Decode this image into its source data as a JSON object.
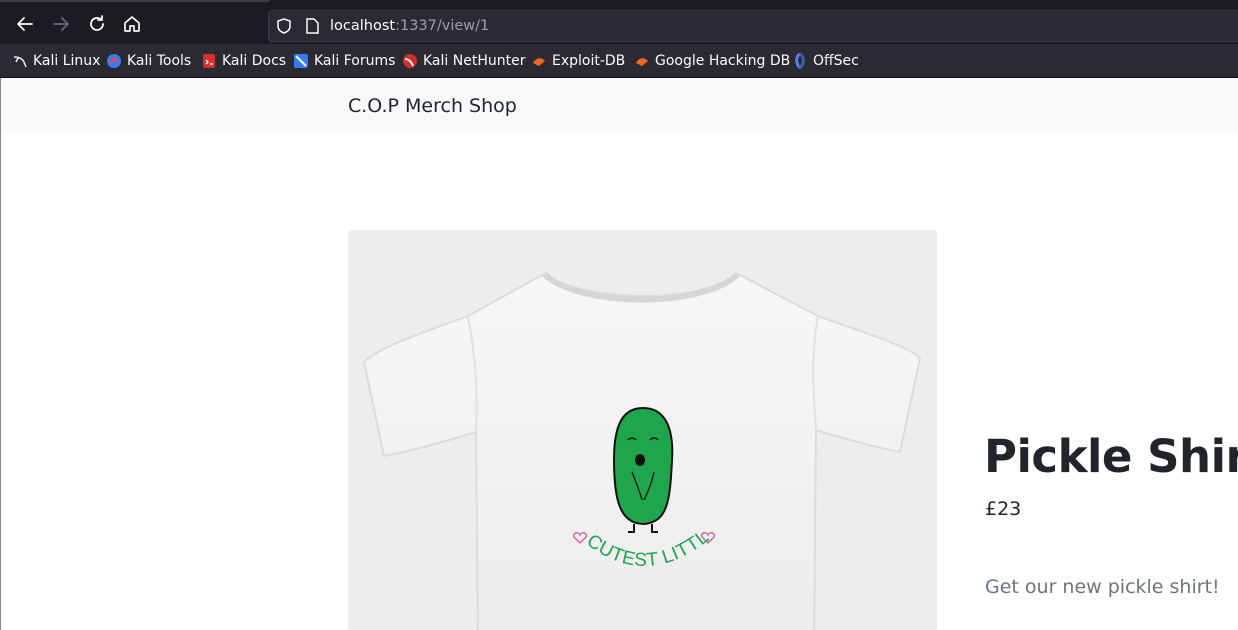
{
  "browser": {
    "url_host": "localhost",
    "url_path": ":1337/view/1",
    "bookmarks": [
      {
        "label": "Kali Linux",
        "icon": "kali-dragon-icon"
      },
      {
        "label": "Kali Tools",
        "icon": "kali-tools-icon"
      },
      {
        "label": "Kali Docs",
        "icon": "kali-docs-icon"
      },
      {
        "label": "Kali Forums",
        "icon": "kali-forums-icon"
      },
      {
        "label": "Kali NetHunter",
        "icon": "kali-nethunter-icon"
      },
      {
        "label": "Exploit-DB",
        "icon": "exploit-db-icon"
      },
      {
        "label": "Google Hacking DB",
        "icon": "ghdb-icon"
      },
      {
        "label": "OffSec",
        "icon": "offsec-icon"
      }
    ]
  },
  "site": {
    "brand": "C.O.P Merch Shop"
  },
  "product": {
    "title": "Pickle Shirt",
    "price": "£23",
    "description": "Get our new pickle shirt!",
    "shirt_print": "CUTEST LITTLE PICKLE"
  },
  "colors": {
    "pickle_green": "#1fa64d",
    "nav_bg": "#f8f9fa",
    "chrome_bg": "#1c1b22"
  }
}
